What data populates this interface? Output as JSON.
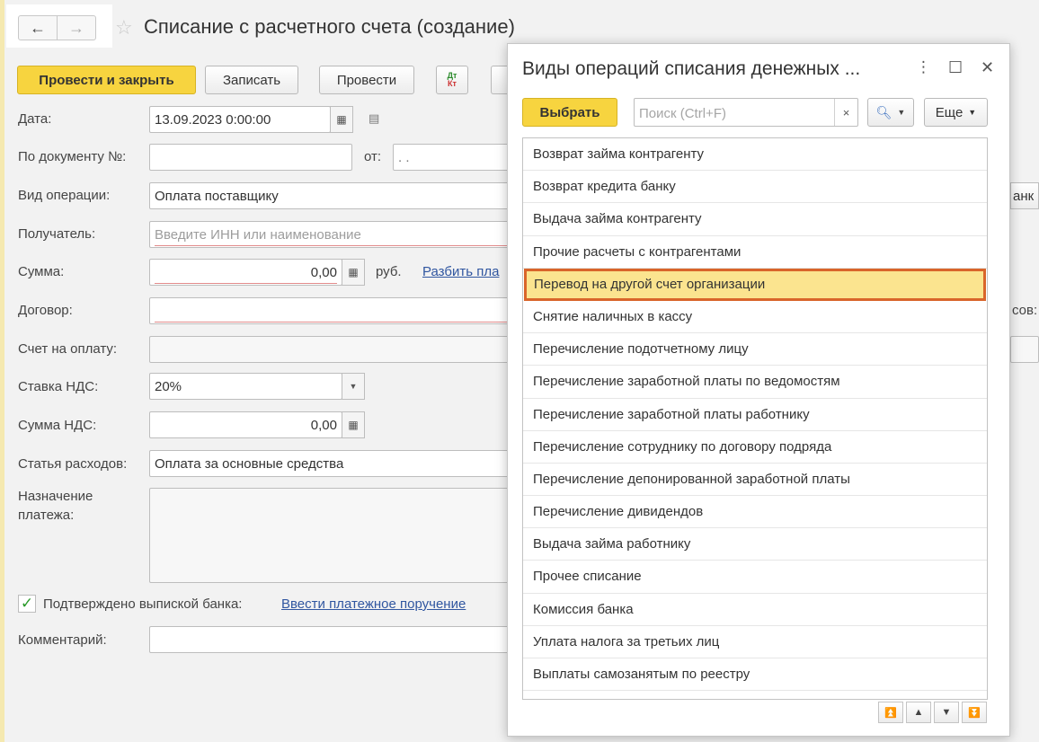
{
  "form": {
    "title": "Списание с расчетного счета (создание)",
    "nav_back": "←",
    "nav_forward": "→",
    "toolbar": {
      "post_close": "Провести и закрыть",
      "save": "Записать",
      "post": "Провести",
      "dtkt_top": "Дт",
      "dtkt_bottom": "Кт"
    },
    "date_label": "Дата:",
    "date_value": "13.09.2023  0:00:00",
    "docnum_label": "По документу №:",
    "from_label": "от:",
    "from_value": " .  .",
    "op_label": "Вид операции:",
    "op_value": "Оплата поставщику",
    "bank_partial": "анк",
    "recipient_label": "Получатель:",
    "recipient_placeholder": "Введите ИНН или наименование",
    "sum_label": "Сумма:",
    "sum_value": "0,00",
    "currency": "руб.",
    "split_link": "Разбить пла",
    "contract_label": "Договор:",
    "right_partial": "сов:",
    "invoice_label": "Счет на оплату:",
    "vat_rate_label": "Ставка НДС:",
    "vat_rate_value": "20%",
    "vat_sum_label": "Сумма НДС:",
    "vat_sum_value": "0,00",
    "expense_label": "Статья расходов:",
    "expense_value": "Оплата за основные средства",
    "purpose_label_1": "Назначение",
    "purpose_label_2": "платежа:",
    "confirmed_label": "Подтверждено выпиской банка:",
    "payment_order_link": "Ввести платежное поручение",
    "comment_label": "Комментарий:"
  },
  "dialog": {
    "title": "Виды операций списания денежных ...",
    "select_button": "Выбрать",
    "search_placeholder": "Поиск (Ctrl+F)",
    "search_clear": "×",
    "more_button": "Еще",
    "selected_index": 4,
    "items": [
      "Возврат займа контрагенту",
      "Возврат кредита банку",
      "Выдача займа контрагенту",
      "Прочие расчеты с контрагентами",
      "Перевод на другой счет организации",
      "Снятие наличных в кассу",
      "Перечисление подотчетному лицу",
      "Перечисление заработной платы по ведомостям",
      "Перечисление заработной платы работнику",
      "Перечисление сотруднику по договору подряда",
      "Перечисление депонированной заработной платы",
      "Перечисление дивидендов",
      "Выдача займа работнику",
      "Прочее списание",
      "Комиссия банка",
      "Уплата налога за третьих лиц",
      "Выплаты самозанятым по реестру"
    ]
  }
}
